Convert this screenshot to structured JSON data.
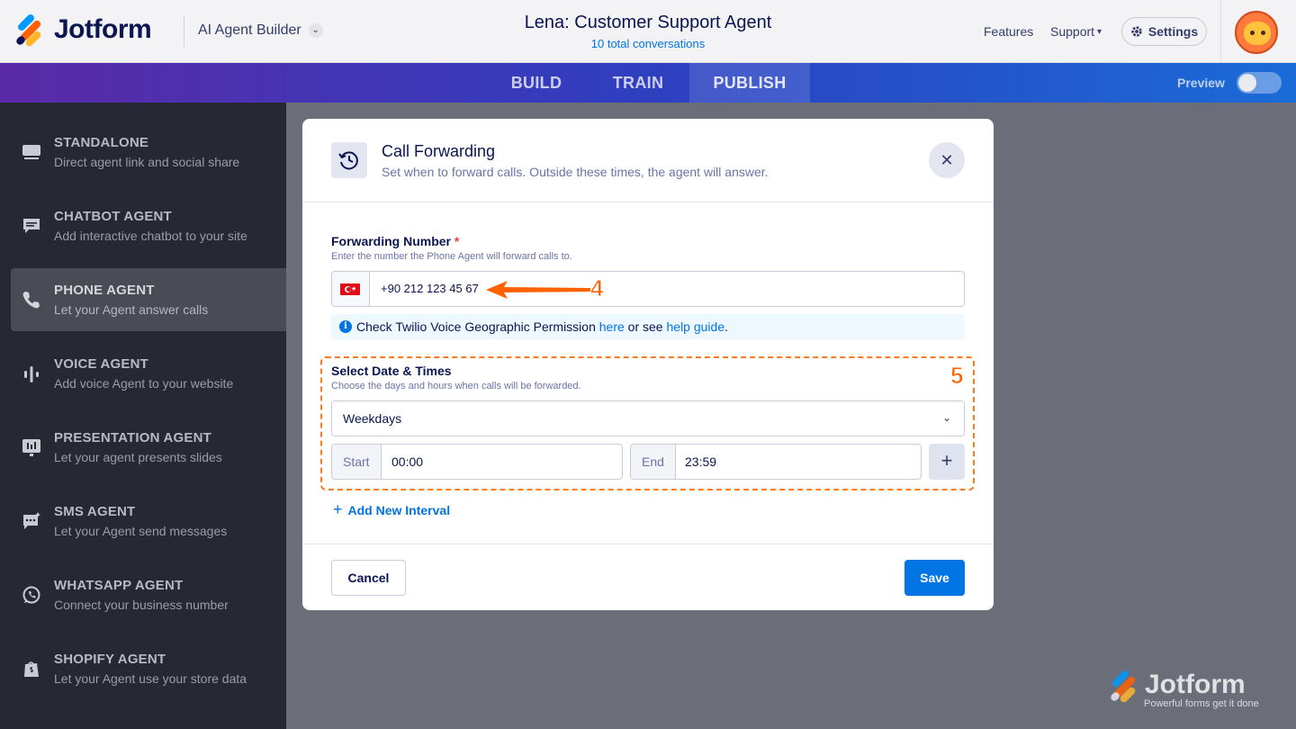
{
  "header": {
    "logo_text": "Jotform",
    "builder_label": "AI Agent Builder",
    "agent_title": "Lena: Customer Support Agent",
    "conversations": "10 total conversations",
    "nav": {
      "features": "Features",
      "support": "Support",
      "settings": "Settings"
    }
  },
  "tabs": [
    {
      "label": "BUILD",
      "active": false
    },
    {
      "label": "TRAIN",
      "active": false
    },
    {
      "label": "PUBLISH",
      "active": true
    }
  ],
  "preview": {
    "label": "Preview",
    "enabled": false
  },
  "sidebar": {
    "items": [
      {
        "title": "STANDALONE",
        "desc": "Direct agent link and social share",
        "icon": "monitor-icon"
      },
      {
        "title": "CHATBOT AGENT",
        "desc": "Add interactive chatbot to your site",
        "icon": "chat-icon"
      },
      {
        "title": "PHONE AGENT",
        "desc": "Let your Agent answer calls",
        "icon": "phone-icon",
        "active": true
      },
      {
        "title": "VOICE AGENT",
        "desc": "Add voice Agent to your website",
        "icon": "voice-wave-icon"
      },
      {
        "title": "PRESENTATION AGENT",
        "desc": "Let your agent presents slides",
        "icon": "presentation-icon"
      },
      {
        "title": "SMS AGENT",
        "desc": "Let your Agent send messages",
        "icon": "sms-icon"
      },
      {
        "title": "WHATSAPP AGENT",
        "desc": "Connect your business number",
        "icon": "whatsapp-icon"
      },
      {
        "title": "SHOPIFY AGENT",
        "desc": "Let your Agent use your store data",
        "icon": "shopify-bag-icon"
      }
    ]
  },
  "modal": {
    "title": "Call Forwarding",
    "subtitle": "Set when to forward calls. Outside these times, the agent will answer.",
    "forwarding": {
      "label": "Forwarding Number",
      "required_mark": "*",
      "hint": "Enter the number the Phone Agent will forward calls to.",
      "country": "TR",
      "number": "+90 212 123 45 67"
    },
    "info": {
      "text_1": "Check Twilio Voice Geographic Permission ",
      "link_1": "here",
      "text_2": " or see ",
      "link_2": "help guide",
      "text_3": "."
    },
    "schedule": {
      "label": "Select Date & Times",
      "hint": "Choose the days and hours when calls will be forwarded.",
      "days": "Weekdays",
      "start_label": "Start",
      "start_value": "00:00",
      "end_label": "End",
      "end_value": "23:59",
      "add_interval": "Add New Interval"
    },
    "cancel_label": "Cancel",
    "save_label": "Save"
  },
  "annotations": {
    "step_4": "4",
    "step_5": "5"
  },
  "watermark": {
    "text": "Jotform",
    "tagline": "Powerful forms get it done"
  },
  "colors": {
    "accent": "#0075e3",
    "annotation": "#ff6100",
    "sidebar_bg": "#262833"
  }
}
